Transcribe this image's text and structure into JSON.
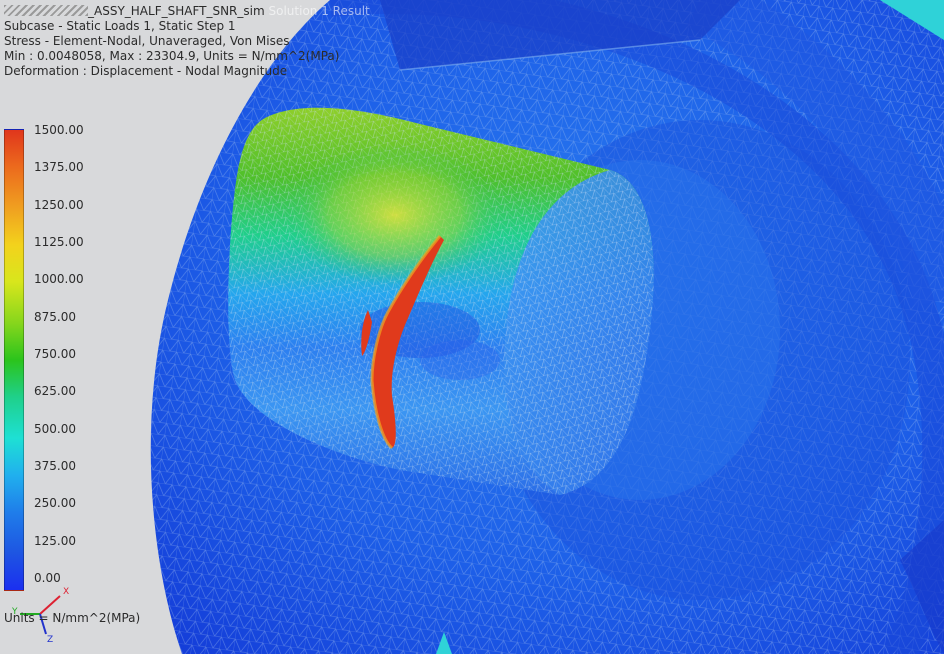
{
  "header": {
    "title_suffix": "_ASSY_HALF_SHAFT_SNR_sim",
    "title_tail": "Solution 1 Result",
    "subcase": "Subcase - Static Loads 1, Static Step 1",
    "stress": "Stress - Element-Nodal, Unaveraged, Von Mises",
    "minmax": "Min : 0.0048058, Max : 23304.9, Units = N/mm^2(MPa)",
    "deformation": "Deformation : Displacement - Nodal Magnitude"
  },
  "legend": {
    "labels": [
      "1500.00",
      "1375.00",
      "1250.00",
      "1125.00",
      "1000.00",
      "875.00",
      "750.00",
      "625.00",
      "500.00",
      "375.00",
      "250.00",
      "125.00",
      "0.00"
    ],
    "colors": [
      "#e0361c",
      "#ec6a1d",
      "#f0a020",
      "#f3d21c",
      "#d8e61c",
      "#86d61c",
      "#2bc41c",
      "#1fd08a",
      "#1ee0d4",
      "#20b0ee",
      "#1f7eea",
      "#1e55e2",
      "#1b2ff0"
    ]
  },
  "triad": {
    "x_label": "X",
    "y_label": "Y",
    "z_label": "Z"
  },
  "units_label": "Units = N/mm^2(MPa)"
}
